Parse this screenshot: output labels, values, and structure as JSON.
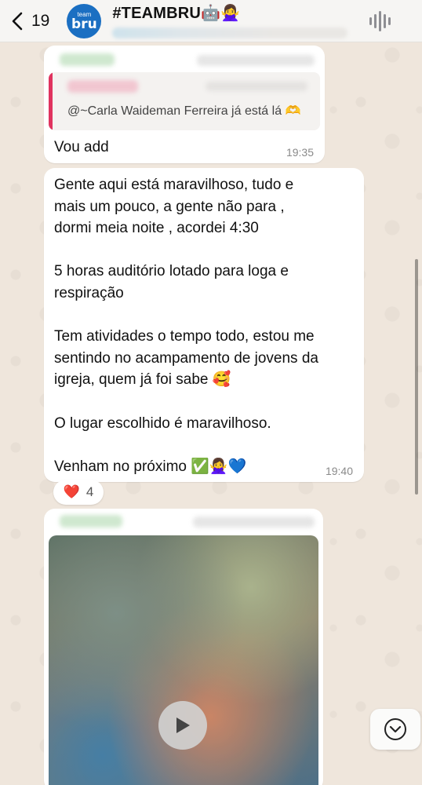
{
  "header": {
    "back_count": "19",
    "avatar_top": "team",
    "avatar_main": "bru",
    "title": "#TEAMBRU🤖🙅‍♀️"
  },
  "messages": [
    {
      "quote_text": "@~Carla Waideman Ferreira já está lá 🫶",
      "text": "Vou add",
      "time": "19:35"
    },
    {
      "paragraphs": [
        "Gente aqui está maravilhoso, tudo e",
        "mais um pouco, a gente não para ,",
        "dormi meia noite , acordei 4:30",
        "",
        "5 horas auditório lotado para loga e",
        "respiração",
        "",
        "Tem atividades o tempo todo, estou me",
        "sentindo no acampamento de jovens da",
        "igreja, quem já foi sabe 🥰",
        "",
        "O lugar escolhido é maravilhoso.",
        "",
        "Venham no próximo ✅🙅‍♀️💙"
      ],
      "time": "19:40",
      "reaction_emoji": "❤️",
      "reaction_count": "4"
    }
  ],
  "icons": {
    "back": "chevron-left-icon",
    "audio": "audio-wave-icon",
    "play": "play-icon",
    "scroll_down": "chevron-down-circle-icon"
  }
}
